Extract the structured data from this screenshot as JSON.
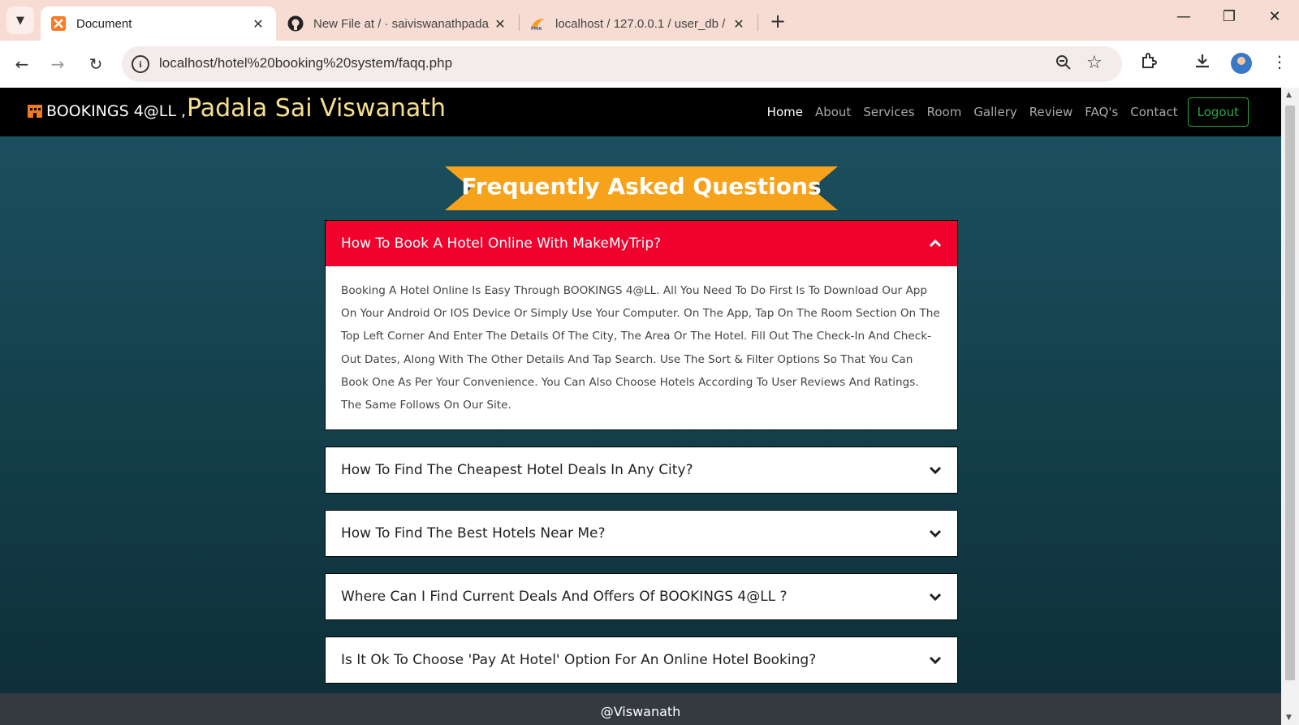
{
  "browser": {
    "tabs": [
      {
        "title": "Document",
        "icon": "xampp-icon"
      },
      {
        "title": "New File at / · saiviswanathpada",
        "icon": "github-icon"
      },
      {
        "title": "localhost / 127.0.0.1 / user_db /",
        "icon": "phpmyadmin-icon"
      }
    ],
    "url": "localhost/hotel%20booking%20system/faqq.php"
  },
  "site": {
    "brand": "BOOKINGS 4@LL ,",
    "owner": "Padala Sai Viswanath",
    "menu": [
      "Home",
      "About",
      "Services",
      "Room",
      "Gallery",
      "Review",
      "FAQ's",
      "Contact"
    ],
    "logout": "Logout"
  },
  "faq": {
    "title": "Frequently Asked Questions",
    "items": [
      {
        "question": "How To Book A Hotel Online With MakeMyTrip?",
        "answer": "Booking A Hotel Online Is Easy Through BOOKINGS 4@LL. All You Need To Do First Is To Download Our App On Your Android Or IOS Device Or Simply Use Your Computer. On The App, Tap On The Room Section On The Top Left Corner And Enter The Details Of The City, The Area Or The Hotel. Fill Out The Check-In And Check-Out Dates, Along With The Other Details And Tap Search. Use The Sort & Filter Options So That You Can Book One As Per Your Convenience. You Can Also Choose Hotels According To User Reviews And Ratings. The Same Follows On Our Site."
      },
      {
        "question": "How To Find The Cheapest Hotel Deals In Any City?"
      },
      {
        "question": "How To Find The Best Hotels Near Me?"
      },
      {
        "question": "Where Can I Find Current Deals And Offers Of BOOKINGS 4@LL ?"
      },
      {
        "question": "Is It Ok To Choose 'Pay At Hotel' Option For An Online Hotel Booking?"
      }
    ]
  },
  "footer": {
    "text": "@Viswanath"
  },
  "colors": {
    "accent_red": "#f0022c",
    "banner_orange": "#f7a21b",
    "owner_yellow": "#f7e08c",
    "logout_green": "#28a745"
  }
}
